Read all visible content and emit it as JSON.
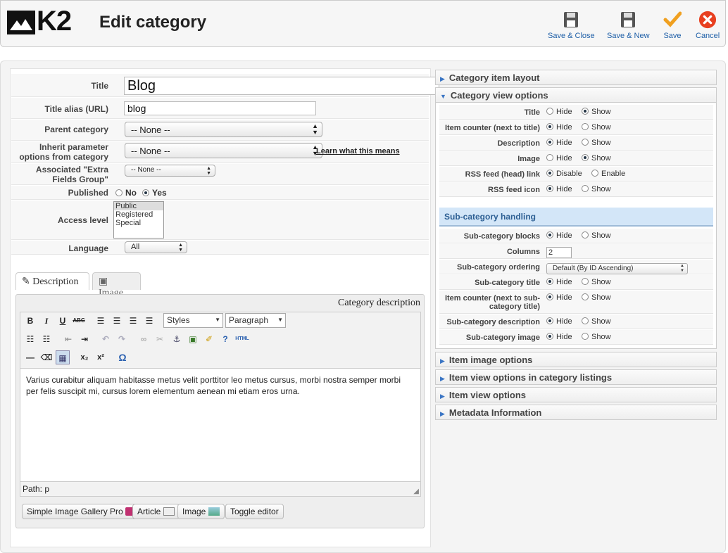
{
  "header": {
    "logo_text": "K2",
    "title": "Edit category",
    "buttons": [
      {
        "label": "Save & Close",
        "icon": "floppy-icon"
      },
      {
        "label": "Save & New",
        "icon": "floppy-icon"
      },
      {
        "label": "Save",
        "icon": "checkmark-icon"
      },
      {
        "label": "Cancel",
        "icon": "cancel-x-icon"
      }
    ]
  },
  "form": {
    "title_label": "Title",
    "title_value": "Blog",
    "alias_label": "Title alias (URL)",
    "alias_value": "blog",
    "parent_label": "Parent category",
    "parent_value": "-- None --",
    "inherit_label_1": "Inherit parameter",
    "inherit_label_2": "options from category",
    "inherit_value": "-- None --",
    "inherit_link": "Learn what this means",
    "extra_label_1": "Associated \"Extra",
    "extra_label_2": "Fields Group\"",
    "extra_value": "-- None --",
    "published_label": "Published",
    "published_no": "No",
    "published_yes": "Yes",
    "access_label": "Access level",
    "access_options": [
      "Public",
      "Registered",
      "Special"
    ],
    "language_label": "Language",
    "language_value": "All"
  },
  "tabs": {
    "description": "Description",
    "image": "Image"
  },
  "editor": {
    "heading": "Category description",
    "styles": "Styles",
    "paragraph": "Paragraph",
    "html_btn": "HTML",
    "content": "Varius curabitur aliquam habitasse metus velit porttitor leo metus cursus, morbi nostra semper morbi per felis suscipit mi, cursus lorem elementum aenean mi etiam eros urna.",
    "path": "Path: p",
    "buttons": [
      "Simple Image Gallery Pro",
      "Article",
      "Image",
      "Toggle editor"
    ]
  },
  "accordion": {
    "item_layout": "Category item layout",
    "view_options": "Category view options",
    "sub_handling": "Sub-category handling",
    "item_image": "Item image options",
    "item_view_listings": "Item view options in category listings",
    "item_view": "Item view options",
    "metadata": "Metadata Information"
  },
  "options": {
    "title": "Title",
    "item_counter": "Item counter (next to title)",
    "description": "Description",
    "image": "Image",
    "rss_link": "RSS feed (head) link",
    "rss_icon": "RSS feed icon",
    "hide": "Hide",
    "show": "Show",
    "disable": "Disable",
    "enable": "Enable",
    "sub_blocks": "Sub-category blocks",
    "columns": "Columns",
    "columns_value": "2",
    "sub_ordering": "Sub-category ordering",
    "sub_ordering_value": "Default (By ID Ascending)",
    "sub_title": "Sub-category title",
    "sub_counter_1": "Item counter (next to sub-",
    "sub_counter_2": "category title)",
    "sub_description": "Sub-category description",
    "sub_image": "Sub-category image"
  }
}
